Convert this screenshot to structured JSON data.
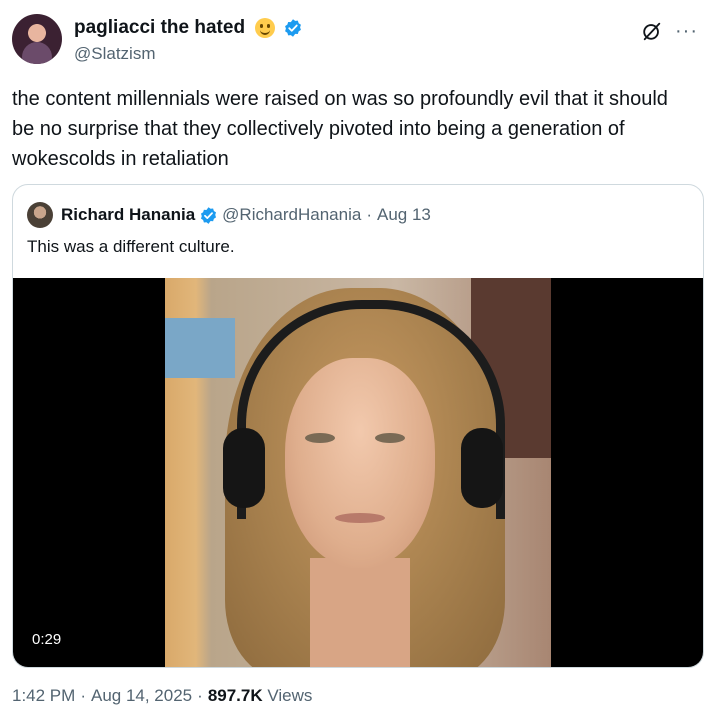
{
  "author": {
    "display_name": "pagliacci the hated",
    "handle": "@Slatzism",
    "emoji_icon": "slightly-smiling-face-icon",
    "verified_color": "#1d9bf0"
  },
  "tweet": {
    "text": "the content millennials were raised on was so profoundly evil that it should be no surprise that they collectively pivoted into being a generation of wokescolds in retaliation"
  },
  "quote": {
    "display_name": "Richard Hanania",
    "handle": "@RichardHanania",
    "separator": "·",
    "date": "Aug 13",
    "text": "This was a different culture.",
    "video_duration": "0:29"
  },
  "meta": {
    "time": "1:42 PM",
    "separator": "·",
    "date": "Aug 14, 2025",
    "views_count": "897.7K",
    "views_label": "Views"
  },
  "icons": {
    "grok": "grok-icon",
    "more": "more-options-icon",
    "more_glyph": "···"
  }
}
